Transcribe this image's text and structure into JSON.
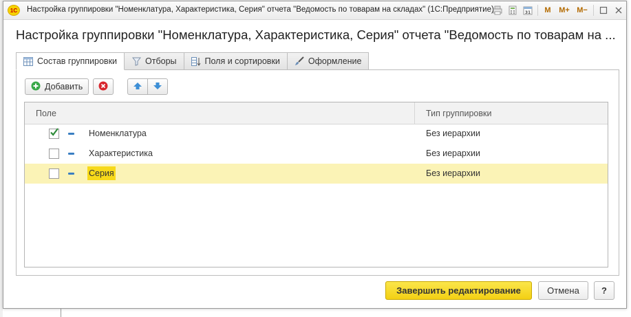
{
  "window": {
    "title": "Настройка группировки \"Номенклатура, Характеристика, Серия\" отчета \"Ведомость по товарам на складах\"  (1С:Предприятие)",
    "app_icon_text": "1С",
    "tools": {
      "m": "M",
      "m_plus": "M+",
      "m_minus": "M−"
    }
  },
  "heading": "Настройка группировки \"Номенклатура, Характеристика, Серия\" отчета \"Ведомость по товарам на ...",
  "tabs": [
    {
      "label": "Состав группировки",
      "icon": "table-icon",
      "active": true
    },
    {
      "label": "Отборы",
      "icon": "filter-icon",
      "active": false
    },
    {
      "label": "Поля и сортировки",
      "icon": "sort-fields-icon",
      "active": false
    },
    {
      "label": "Оформление",
      "icon": "brush-icon",
      "active": false
    }
  ],
  "toolbar": {
    "add_label": "Добавить"
  },
  "grid": {
    "columns": [
      "Поле",
      "Тип группировки"
    ],
    "rows": [
      {
        "name": "Номенклатура",
        "type": "Без иерархии",
        "checked": true,
        "selected": false
      },
      {
        "name": "Характеристика",
        "type": "Без иерархии",
        "checked": false,
        "selected": false
      },
      {
        "name": "Серия",
        "type": "Без иерархии",
        "checked": false,
        "selected": true
      }
    ]
  },
  "footer": {
    "finish_label": "Завершить редактирование",
    "cancel_label": "Отмена",
    "help_label": "?"
  },
  "colors": {
    "accent_yellow": "#f7d91a",
    "selected_row": "#fbf3b6",
    "check_green": "#2e8b3a",
    "dash_blue": "#3a7fc2"
  }
}
